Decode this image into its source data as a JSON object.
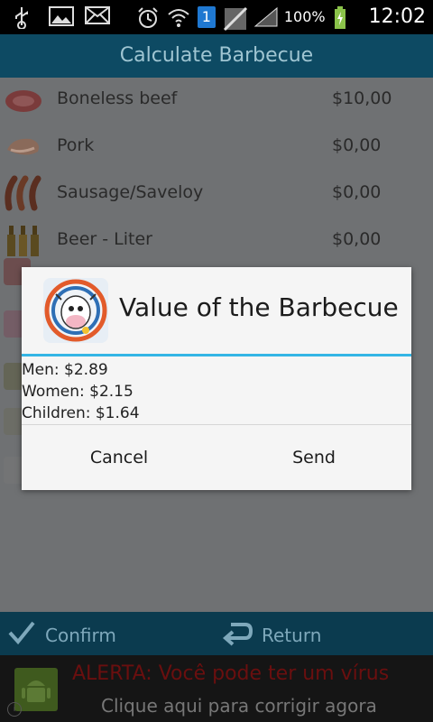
{
  "status_bar": {
    "battery": "100%",
    "notification_count": "1",
    "time": "12:02"
  },
  "title": "Calculate Barbecue",
  "items": [
    {
      "name": "Boneless beef",
      "price": "$10,00",
      "icon": "beef-icon"
    },
    {
      "name": "Pork",
      "price": "$0,00",
      "icon": "pork-icon"
    },
    {
      "name": "Sausage/Saveloy",
      "price": "$0,00",
      "icon": "sausage-icon"
    },
    {
      "name": "Beer - Liter",
      "price": "$0,00",
      "icon": "beer-icon"
    }
  ],
  "dialog": {
    "title": "Value of the Barbecue",
    "lines": [
      "Men: $2.89",
      "Women: $2.15",
      "Children: $1.64"
    ],
    "cancel_label": "Cancel",
    "send_label": "Send"
  },
  "bottom_bar": {
    "confirm_label": "Confirm",
    "return_label": "Return"
  },
  "ad": {
    "line1": "ALERTA: Você pode ter um vírus",
    "line2": "Clique aqui para corrigir agora"
  }
}
